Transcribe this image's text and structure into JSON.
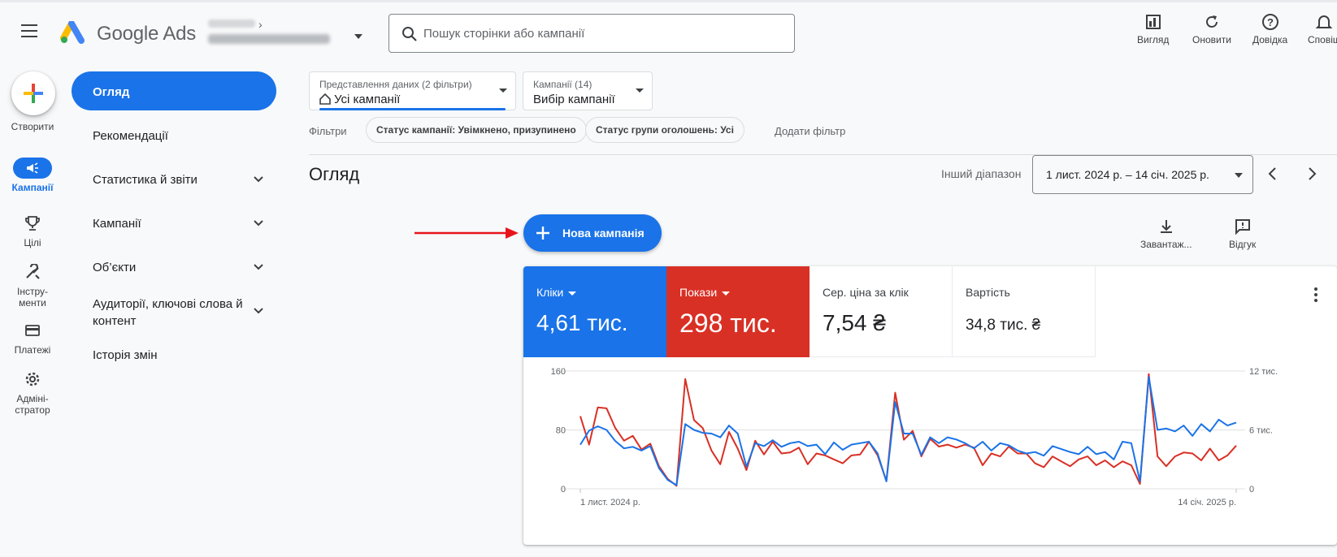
{
  "header": {
    "brand": "Google Ads",
    "account_chevron": "›",
    "search_placeholder": "Пошук сторінки або кампанії",
    "tools": [
      "Вигляд",
      "Оновити",
      "Довідка",
      "Сповіщ"
    ]
  },
  "rail": {
    "create": "Створити",
    "items": [
      {
        "label": "Кампанії",
        "icon": "megaphone-icon",
        "active": true
      },
      {
        "label": "Цілі",
        "icon": "trophy-icon"
      },
      {
        "label": "Інстру-\nменти",
        "icon": "tools-icon"
      },
      {
        "label": "Платежі",
        "icon": "credit-card-icon"
      },
      {
        "label": "Адміні-\nстратор",
        "icon": "gear-icon"
      }
    ]
  },
  "nav": {
    "items": [
      {
        "label": "Огляд",
        "active": true
      },
      {
        "label": "Рекомендації"
      },
      {
        "label": "Статистика й звіти",
        "expandable": true
      },
      {
        "label": "Кампанії",
        "expandable": true
      },
      {
        "label": "Об’єкти",
        "expandable": true
      },
      {
        "label": "Аудиторії, ключові слова й контент",
        "expandable": true
      },
      {
        "label": "Історія змін"
      }
    ]
  },
  "main": {
    "view_dropdown": {
      "label": "Представлення даних (2 фільтри)",
      "value": "Усі кампанії"
    },
    "campaign_dropdown": {
      "label": "Кампанії (14)",
      "value": "Вибір кампанії"
    },
    "filters_label": "Фільтри",
    "chips": [
      "Статус кампанії: Увімкнено, призупинено",
      "Статус групи оголошень: Усі"
    ],
    "add_filter": "Додати фільтр",
    "title": "Огляд",
    "range_label": "Інший діапазон",
    "range_value": "1 лист. 2024 р. – 14 січ. 2025 р.",
    "new_campaign": "Нова кампанія",
    "download": "Завантаж...",
    "feedback": "Відгук"
  },
  "metrics": [
    {
      "name": "Кліки",
      "value": "4,61 тис.",
      "style": "blue"
    },
    {
      "name": "Покази",
      "value": "298 тис.",
      "style": "red"
    },
    {
      "name": "Сер. ціна за клік",
      "value": "7,54 ₴"
    },
    {
      "name": "Вартість",
      "value": "34,8 тис. ₴"
    }
  ],
  "colors": {
    "accent": "#1a73e8",
    "red": "#d93025",
    "annotation_arrow": "#e8141c"
  },
  "chart_data": {
    "type": "line",
    "x_start": "1 лист. 2024 р.",
    "x_end": "14 січ. 2025 р.",
    "left_ticks": [
      "160",
      "80",
      "0"
    ],
    "right_ticks": [
      "12 тис.",
      "6 тис.",
      "0"
    ],
    "ylim_left": [
      0,
      160
    ],
    "ylim_right": [
      0,
      12000
    ],
    "series": [
      {
        "name": "Кліки",
        "color": "#1a73e8",
        "axis": "left",
        "values": [
          60,
          79,
          85,
          80,
          65,
          55,
          57,
          52,
          58,
          28,
          12,
          5,
          88,
          80,
          76,
          75,
          70,
          86,
          75,
          30,
          62,
          58,
          66,
          57,
          62,
          64,
          58,
          60,
          47,
          63,
          53,
          60,
          62,
          64,
          48,
          10,
          118,
          75,
          75,
          46,
          70,
          62,
          70,
          67,
          62,
          55,
          64,
          52,
          62,
          59,
          52,
          48,
          50,
          45,
          58,
          54,
          50,
          47,
          57,
          47,
          50,
          40,
          64,
          62,
          10,
          152,
          80,
          82,
          78,
          86,
          72,
          88,
          78,
          94,
          86,
          90
        ],
        "_comment": "76 days"
      },
      {
        "name": "Покази",
        "color": "#d93025",
        "axis": "right",
        "values": [
          7400,
          4500,
          8300,
          8200,
          6200,
          4900,
          5400,
          4000,
          4600,
          2300,
          1000,
          300,
          11200,
          7000,
          6200,
          3900,
          2500,
          5800,
          4100,
          1900,
          4900,
          3500,
          4800,
          3600,
          3700,
          4200,
          2500,
          3600,
          3400,
          3000,
          2600,
          3400,
          3500,
          4800,
          3400,
          800,
          9800,
          5000,
          5900,
          3300,
          5100,
          4300,
          4500,
          4200,
          4500,
          4200,
          2400,
          3600,
          3300,
          4300,
          3600,
          3600,
          2600,
          2200,
          3300,
          2800,
          2300,
          3000,
          3300,
          2400,
          2900,
          2200,
          2800,
          2400,
          500,
          11700,
          3300,
          2300,
          3300,
          3700,
          3600,
          2900,
          4100,
          2900,
          3400,
          4400
        ]
      }
    ]
  }
}
